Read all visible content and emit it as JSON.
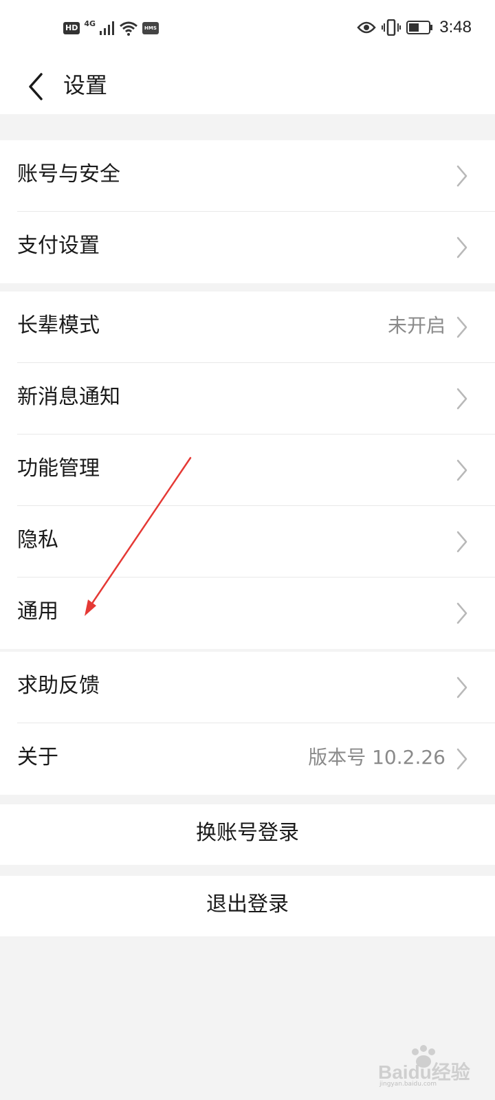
{
  "status_bar": {
    "left_badges": {
      "hd": "HD",
      "network": "4G",
      "hms": "HMS"
    },
    "time": "3:48",
    "icons": [
      "signal-icon",
      "wifi-icon",
      "eye-icon",
      "vibrate-icon",
      "battery-icon"
    ]
  },
  "nav": {
    "back_icon": "chevron-left-icon",
    "title": "设置"
  },
  "groups": [
    {
      "items": [
        {
          "label": "账号与安全",
          "value": ""
        },
        {
          "label": "支付设置",
          "value": ""
        }
      ]
    },
    {
      "items": [
        {
          "label": "长辈模式",
          "value": "未开启"
        },
        {
          "label": "新消息通知",
          "value": ""
        },
        {
          "label": "功能管理",
          "value": ""
        },
        {
          "label": "隐私",
          "value": ""
        },
        {
          "label": "通用",
          "value": ""
        }
      ]
    },
    {
      "items": [
        {
          "label": "求助反馈",
          "value": ""
        },
        {
          "label": "关于",
          "value": "版本号 10.2.26"
        }
      ]
    }
  ],
  "actions": {
    "switch_account": "换账号登录",
    "logout": "退出登录"
  },
  "annotation": {
    "arrow_color": "#e53935"
  },
  "watermark": {
    "logo": "Baidu经验",
    "site": "jingyan.baidu.com"
  },
  "colors": {
    "background": "#f3f3f3",
    "row_background": "#ffffff",
    "text": "#1a1a1a",
    "secondary_text": "#8a8a8a",
    "chevron": "#b8b8b8"
  }
}
